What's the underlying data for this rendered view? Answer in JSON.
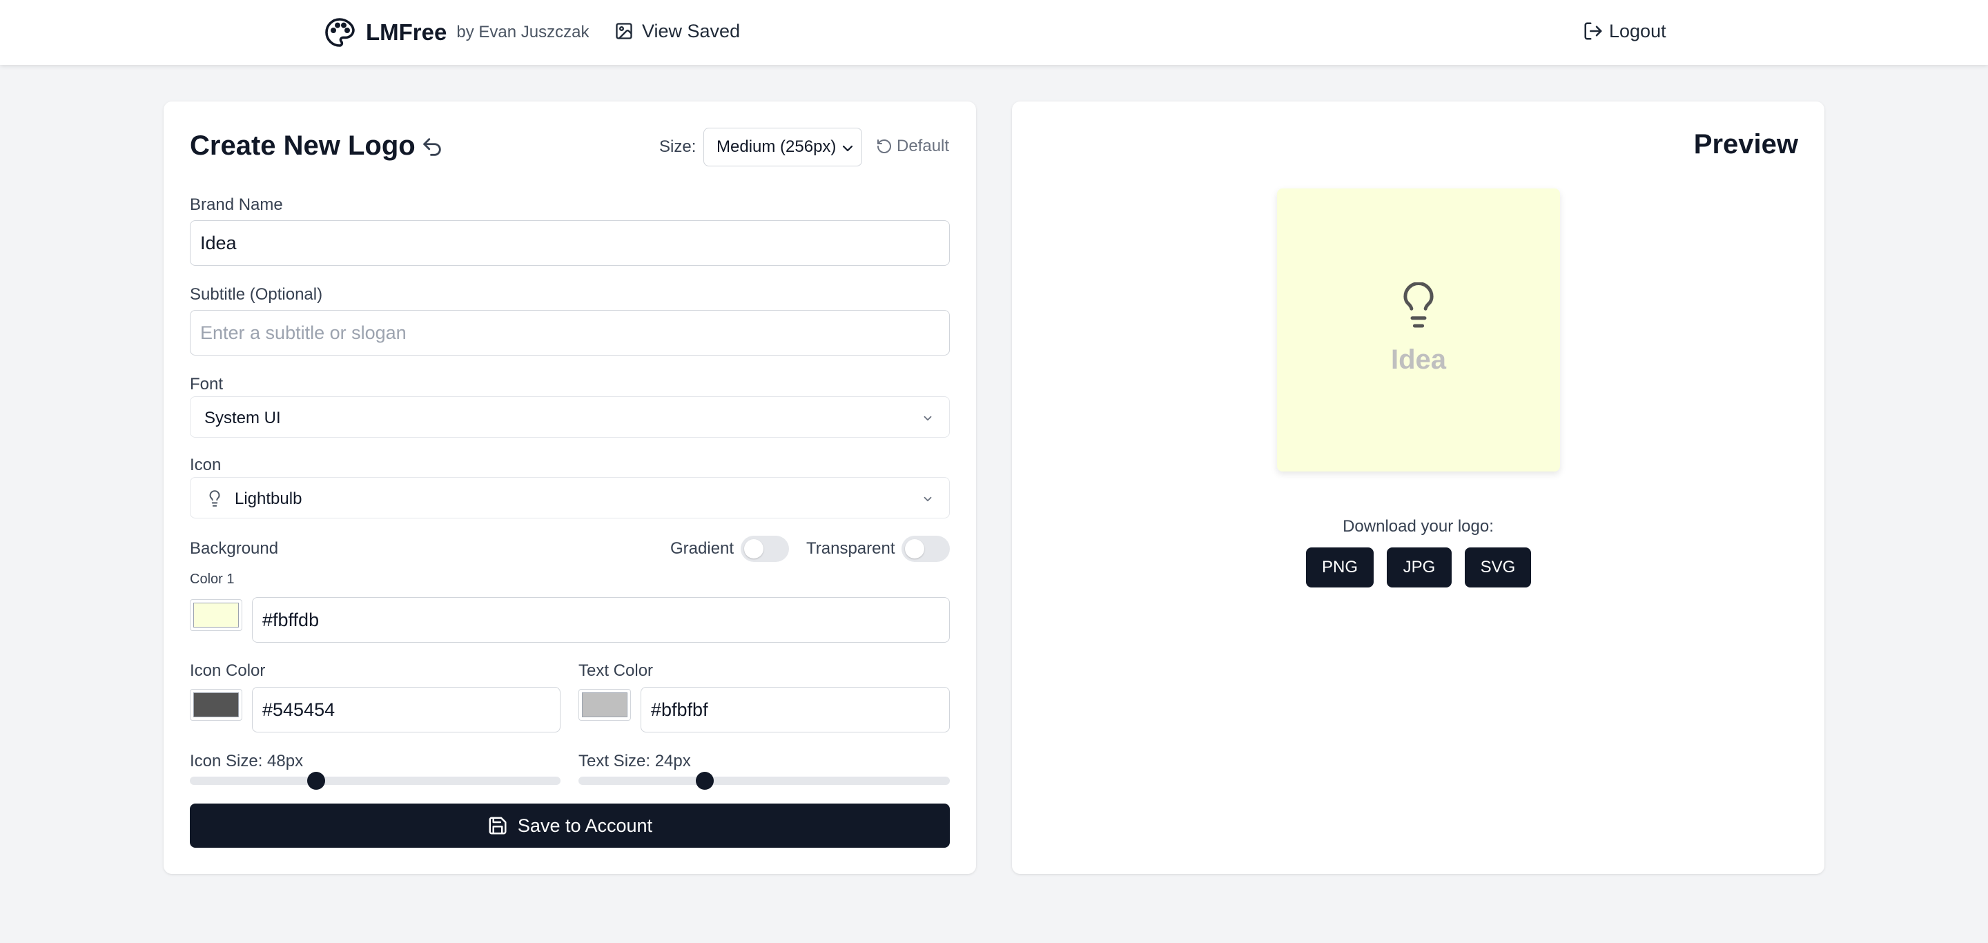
{
  "colors": {
    "accent": "#111827",
    "page_bg": "#f3f4f6",
    "toggle_off": "#e5e7eb"
  },
  "nav": {
    "brand_icon": "palette-icon",
    "brand_name": "LMFree",
    "brand_by": "by Evan Juszczak",
    "saved_icon": "image-icon",
    "saved_label": "View Saved",
    "logout_icon": "logout-icon",
    "logout_label": "Logout"
  },
  "editor": {
    "title": "Create New Logo",
    "undo_icon": "undo-icon",
    "size_label": "Size:",
    "size_value": "Medium (256px)",
    "default_icon": "reset-icon",
    "default_label": "Default",
    "brand_name": {
      "label": "Brand Name",
      "value": "Idea"
    },
    "subtitle": {
      "label": "Subtitle (Optional)",
      "value": "",
      "placeholder": "Enter a subtitle or slogan"
    },
    "font": {
      "label": "Font",
      "value": "System UI"
    },
    "icon": {
      "label": "Icon",
      "value": "Lightbulb",
      "icon_name": "lightbulb-icon"
    },
    "background": {
      "label": "Background",
      "gradient_label": "Gradient",
      "gradient_on": false,
      "transparent_label": "Transparent",
      "transparent_on": false,
      "color1_label": "Color 1",
      "color1": "#fbffdb"
    },
    "icon_color": {
      "label": "Icon Color",
      "value": "#545454"
    },
    "text_color": {
      "label": "Text Color",
      "value": "#bfbfbf"
    },
    "icon_size": {
      "label": "Icon Size: 48px",
      "value": 48
    },
    "text_size": {
      "label": "Text Size: 24px",
      "value": 24
    },
    "save_icon": "save-icon",
    "save_label": "Save to Account"
  },
  "preview": {
    "title": "Preview",
    "brand_text": "Idea",
    "icon_name": "lightbulb-icon",
    "bg_color": "#fbffdb",
    "icon_color": "#545454",
    "text_color": "#bfbfbf",
    "download_label": "Download your logo:",
    "formats": [
      "PNG",
      "JPG",
      "SVG"
    ]
  }
}
